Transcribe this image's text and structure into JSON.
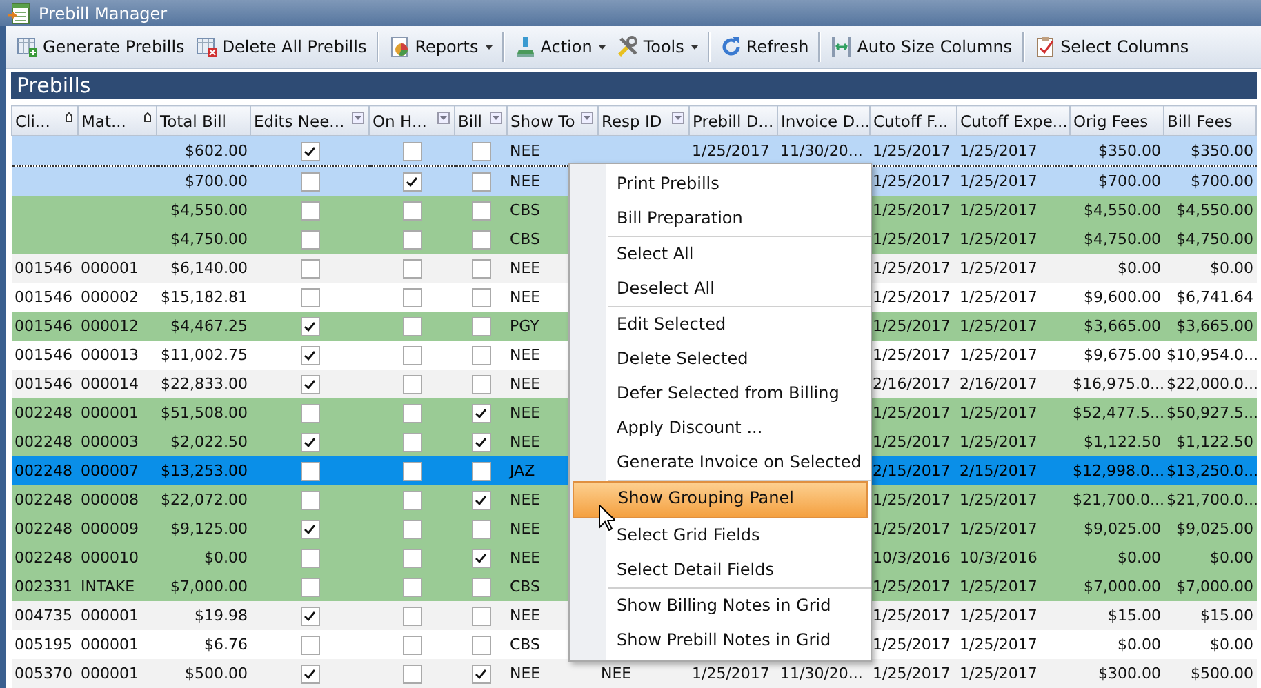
{
  "window": {
    "title": "Prebill Manager"
  },
  "toolbar": {
    "groups": [
      [
        {
          "label": "Generate Prebills",
          "dropdown": false
        },
        {
          "label": "Delete All Prebills",
          "dropdown": false
        }
      ],
      [
        {
          "label": "Reports",
          "dropdown": true
        }
      ],
      [
        {
          "label": "Action",
          "dropdown": true
        },
        {
          "label": "Tools",
          "dropdown": true
        }
      ],
      [
        {
          "label": "Refresh",
          "dropdown": false
        }
      ],
      [
        {
          "label": "Auto Size Columns",
          "dropdown": false
        }
      ],
      [
        {
          "label": "Select Columns",
          "dropdown": false
        }
      ]
    ]
  },
  "panel": {
    "title": "Prebills"
  },
  "table": {
    "columns": [
      {
        "label": "Cli...",
        "kind": "sort"
      },
      {
        "label": "Mat...",
        "kind": "sort"
      },
      {
        "label": "Total Bill",
        "kind": "plain"
      },
      {
        "label": "Edits Nee...",
        "kind": "filter"
      },
      {
        "label": "On H...",
        "kind": "filter"
      },
      {
        "label": "Bill",
        "kind": "filter"
      },
      {
        "label": "Show To",
        "kind": "filter"
      },
      {
        "label": "Resp ID",
        "kind": "filter"
      },
      {
        "label": "Prebill D...",
        "kind": "plain"
      },
      {
        "label": "Invoice D...",
        "kind": "plain"
      },
      {
        "label": "Cutoff F...",
        "kind": "plain"
      },
      {
        "label": "Cutoff Expe...",
        "kind": "plain"
      },
      {
        "label": "Orig Fees",
        "kind": "plain"
      },
      {
        "label": "Bill Fees",
        "kind": "plain"
      }
    ],
    "rows": [
      {
        "color": "#b9d7f7",
        "focused": true,
        "client": "",
        "matter": "",
        "total": "$602.00",
        "edits": true,
        "on_hold": false,
        "bill": false,
        "show_to": "NEE",
        "prebill_date": "1/25/2017",
        "invoice_date": "11/30/20...",
        "cutoff_fees": "1/25/2017",
        "cutoff_expenses": "1/25/2017",
        "orig_fees": "$350.00",
        "bill_fees": "$350.00"
      },
      {
        "color": "#b9d7f7",
        "focused": false,
        "client": "",
        "matter": "",
        "total": "$700.00",
        "edits": false,
        "on_hold": true,
        "bill": false,
        "show_to": "NEE",
        "cutoff_fees": "1/25/2017",
        "cutoff_expenses": "1/25/2017",
        "orig_fees": "$700.00",
        "bill_fees": "$700.00"
      },
      {
        "color": "#9acb95",
        "focused": false,
        "client": "",
        "matter": "",
        "total": "$4,550.00",
        "edits": false,
        "on_hold": false,
        "bill": false,
        "show_to": "CBS",
        "cutoff_fees": "1/25/2017",
        "cutoff_expenses": "1/25/2017",
        "orig_fees": "$4,550.00",
        "bill_fees": "$4,550.00"
      },
      {
        "color": "#9acb95",
        "focused": false,
        "client": "",
        "matter": "",
        "total": "$4,750.00",
        "edits": false,
        "on_hold": false,
        "bill": false,
        "show_to": "CBS",
        "cutoff_fees": "1/25/2017",
        "cutoff_expenses": "1/25/2017",
        "orig_fees": "$4,750.00",
        "bill_fees": "$4,750.00"
      },
      {
        "color": "#f2f2f2",
        "focused": false,
        "client": "001546",
        "matter": "000001",
        "total": "$6,140.00",
        "edits": false,
        "on_hold": false,
        "bill": false,
        "show_to": "NEE",
        "cutoff_fees": "1/25/2017",
        "cutoff_expenses": "1/25/2017",
        "orig_fees": "$0.00",
        "bill_fees": "$0.00"
      },
      {
        "color": "#ffffff",
        "focused": false,
        "client": "001546",
        "matter": "000002",
        "total": "$15,182.81",
        "edits": false,
        "on_hold": false,
        "bill": false,
        "show_to": "NEE",
        "cutoff_fees": "1/25/2017",
        "cutoff_expenses": "1/25/2017",
        "orig_fees": "$9,600.00",
        "bill_fees": "$6,741.64"
      },
      {
        "color": "#9acb95",
        "focused": false,
        "client": "001546",
        "matter": "000012",
        "total": "$4,467.25",
        "edits": true,
        "on_hold": false,
        "bill": false,
        "show_to": "PGY",
        "cutoff_fees": "1/25/2017",
        "cutoff_expenses": "1/25/2017",
        "orig_fees": "$3,665.00",
        "bill_fees": "$3,665.00"
      },
      {
        "color": "#ffffff",
        "focused": false,
        "client": "001546",
        "matter": "000013",
        "total": "$11,002.75",
        "edits": true,
        "on_hold": false,
        "bill": false,
        "show_to": "NEE",
        "cutoff_fees": "1/25/2017",
        "cutoff_expenses": "1/25/2017",
        "orig_fees": "$9,675.00",
        "bill_fees": "$10,954.0..."
      },
      {
        "color": "#f2f2f2",
        "focused": false,
        "client": "001546",
        "matter": "000014",
        "total": "$22,833.00",
        "edits": true,
        "on_hold": false,
        "bill": false,
        "show_to": "NEE",
        "cutoff_fees": "2/16/2017",
        "cutoff_expenses": "2/16/2017",
        "orig_fees": "$16,975.0...",
        "bill_fees": "$22,000.0..."
      },
      {
        "color": "#9acb95",
        "focused": false,
        "client": "002248",
        "matter": "000001",
        "total": "$51,508.00",
        "edits": false,
        "on_hold": false,
        "bill": true,
        "show_to": "NEE",
        "cutoff_fees": "1/25/2017",
        "cutoff_expenses": "1/25/2017",
        "orig_fees": "$52,477.5...",
        "bill_fees": "$50,927.5..."
      },
      {
        "color": "#9acb95",
        "focused": false,
        "client": "002248",
        "matter": "000003",
        "total": "$2,022.50",
        "edits": true,
        "on_hold": false,
        "bill": true,
        "show_to": "NEE",
        "cutoff_fees": "1/25/2017",
        "cutoff_expenses": "1/25/2017",
        "orig_fees": "$1,122.50",
        "bill_fees": "$1,122.50"
      },
      {
        "color": "#0a8fe8",
        "focused": false,
        "client": "002248",
        "matter": "000007",
        "total": "$13,253.00",
        "edits": false,
        "on_hold": false,
        "bill": false,
        "show_to": "JAZ",
        "cutoff_fees": "2/15/2017",
        "cutoff_expenses": "2/15/2017",
        "orig_fees": "$12,998.0...",
        "bill_fees": "$13,250.0..."
      },
      {
        "color": "#9acb95",
        "focused": false,
        "client": "002248",
        "matter": "000008",
        "total": "$22,072.00",
        "edits": false,
        "on_hold": false,
        "bill": true,
        "show_to": "NEE",
        "cutoff_fees": "1/25/2017",
        "cutoff_expenses": "1/25/2017",
        "orig_fees": "$21,700.0...",
        "bill_fees": "$21,700.0..."
      },
      {
        "color": "#9acb95",
        "focused": false,
        "client": "002248",
        "matter": "000009",
        "total": "$9,125.00",
        "edits": true,
        "on_hold": false,
        "bill": false,
        "show_to": "NEE",
        "cutoff_fees": "1/25/2017",
        "cutoff_expenses": "1/25/2017",
        "orig_fees": "$9,025.00",
        "bill_fees": "$9,025.00"
      },
      {
        "color": "#9acb95",
        "focused": false,
        "client": "002248",
        "matter": "000010",
        "total": "$0.00",
        "edits": false,
        "on_hold": false,
        "bill": true,
        "show_to": "NEE",
        "cutoff_fees": "10/3/2016",
        "cutoff_expenses": "10/3/2016",
        "orig_fees": "$0.00",
        "bill_fees": "$0.00"
      },
      {
        "color": "#9acb95",
        "focused": false,
        "client": "002331",
        "matter": "INTAKE",
        "total": "$7,000.00",
        "edits": false,
        "on_hold": false,
        "bill": false,
        "show_to": "CBS",
        "cutoff_fees": "1/25/2017",
        "cutoff_expenses": "1/25/2017",
        "orig_fees": "$7,000.00",
        "bill_fees": "$7,000.00"
      },
      {
        "color": "#f2f2f2",
        "focused": false,
        "client": "004735",
        "matter": "000001",
        "total": "$19.98",
        "edits": true,
        "on_hold": false,
        "bill": false,
        "show_to": "NEE",
        "cutoff_fees": "1/25/2017",
        "cutoff_expenses": "1/25/2017",
        "orig_fees": "$15.00",
        "bill_fees": "$15.00"
      },
      {
        "color": "#ffffff",
        "focused": false,
        "client": "005195",
        "matter": "000001",
        "total": "$6.76",
        "edits": false,
        "on_hold": false,
        "bill": false,
        "show_to": "CBS",
        "cutoff_fees": "1/25/2017",
        "cutoff_expenses": "1/25/2017",
        "orig_fees": "$0.00",
        "bill_fees": "$0.00"
      },
      {
        "color": "#f2f2f2",
        "focused": false,
        "client": "005370",
        "matter": "000001",
        "total": "$500.00",
        "edits": true,
        "on_hold": false,
        "bill": true,
        "show_to": "NEE",
        "resp_id": "NEE",
        "prebill_date": "1/25/2017",
        "invoice_date": "11/30/20...",
        "cutoff_fees": "1/25/2017",
        "cutoff_expenses": "1/25/2017",
        "orig_fees": "$300.00",
        "bill_fees": "$500.00"
      }
    ]
  },
  "context_menu": {
    "sections": [
      [
        {
          "label": "Print Prebills",
          "selected": false
        },
        {
          "label": "Bill Preparation",
          "selected": false
        }
      ],
      [
        {
          "label": "Select All",
          "selected": false
        },
        {
          "label": "Deselect All",
          "selected": false
        }
      ],
      [
        {
          "label": "Edit Selected",
          "selected": false
        },
        {
          "label": "Delete Selected",
          "selected": false
        },
        {
          "label": "Defer Selected from Billing",
          "selected": false
        },
        {
          "label": "Apply Discount ...",
          "selected": false
        },
        {
          "label": "Generate Invoice on Selected",
          "selected": false
        }
      ],
      [
        {
          "label": "Show Grouping Panel",
          "selected": true
        },
        {
          "label": "Select Grid Fields",
          "selected": false
        },
        {
          "label": "Select Detail Fields",
          "selected": false
        }
      ],
      [
        {
          "label": "Show Billing Notes in Grid",
          "selected": false
        },
        {
          "label": "Show Prebill Notes in Grid",
          "selected": false
        }
      ]
    ]
  }
}
